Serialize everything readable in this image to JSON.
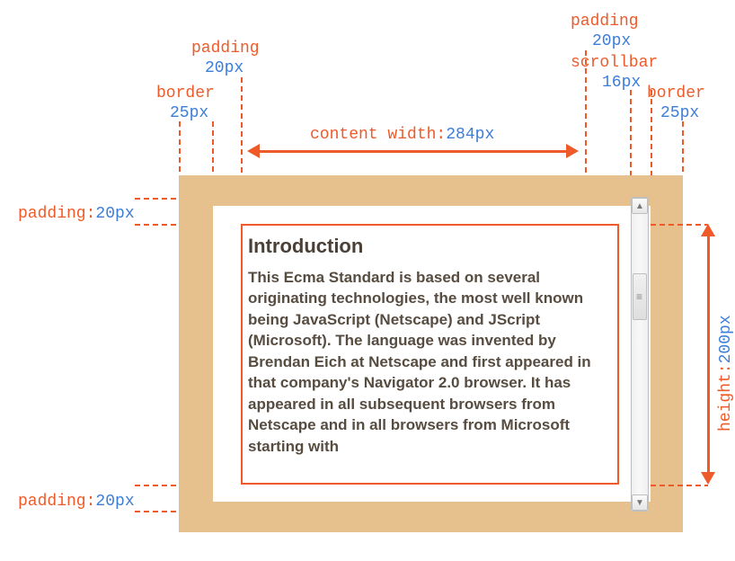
{
  "topLabels": {
    "padding_left": {
      "name": "padding",
      "value": "20px"
    },
    "border_left": {
      "name": "border",
      "value": "25px"
    },
    "padding_right": {
      "name": "padding",
      "value": "20px"
    },
    "scrollbar": {
      "name": "scrollbar",
      "value": "16px"
    },
    "border_right": {
      "name": "border",
      "value": "25px"
    }
  },
  "sideLabels": {
    "padding_top": {
      "name": "padding:",
      "value": "20px"
    },
    "padding_bottom": {
      "name": "padding:",
      "value": "20px"
    }
  },
  "dimensions": {
    "content_width_label": "content width:",
    "content_width_value": "284px",
    "height_label": "height:",
    "height_value": "200px"
  },
  "content": {
    "heading": "Introduction",
    "body": "This Ecma Standard is based on several originating technologies, the most well known being JavaScript (Netscape) and JScript (Microsoft). The language was invented by Brendan Eich at Netscape and first appeared in that company's Navigator 2.0 browser. It has appeared in all subsequent browsers from Netscape and in all browsers from Microsoft starting with"
  }
}
